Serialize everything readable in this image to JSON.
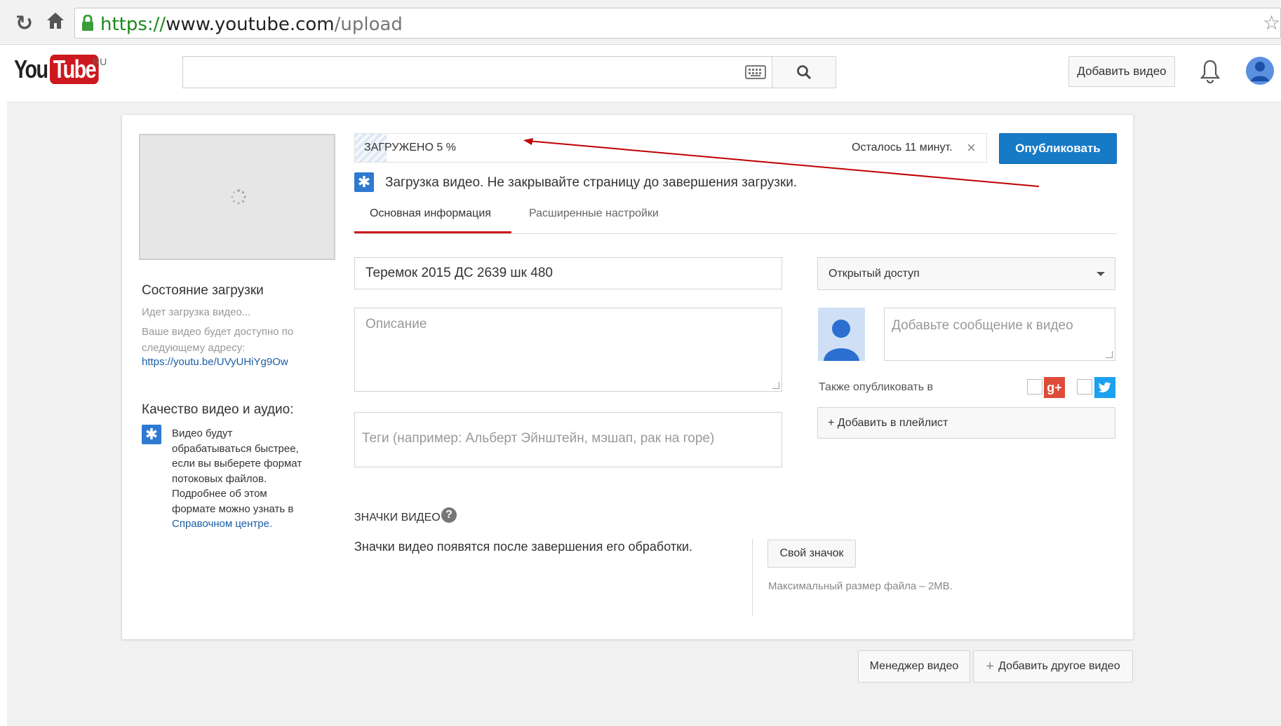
{
  "browser": {
    "url_scheme": "https://",
    "url_host": "www.youtube.com",
    "url_path": "/upload"
  },
  "header": {
    "logo_you": "You",
    "logo_tube": "Tube",
    "region": "RU",
    "upload_button": "Добавить видео"
  },
  "upload": {
    "progress_label": "ЗАГРУЖЕНО 5 %",
    "progress_percent": 5,
    "time_left": "Осталось 11 минут.",
    "publish_button": "Опубликовать",
    "notice": "Загрузка видео. Не закрывайте страницу до завершения загрузки."
  },
  "tabs": [
    {
      "label": "Основная информация",
      "active": true
    },
    {
      "label": "Расширенные настройки",
      "active": false
    }
  ],
  "sidebar": {
    "status_title": "Состояние загрузки",
    "status_text": "Идет загрузка видео...",
    "address_text_1": "Ваше видео будет доступно по",
    "address_text_2": "следующему адресу:",
    "video_link": "https://youtu.be/UVyUHiYg9Ow",
    "quality_title": "Качество видео и аудио:",
    "quality_lines": [
      "Видео будут",
      "обрабатываться быстрее,",
      "если вы выберете формат",
      "потоковых файлов.",
      "Подробнее об этом",
      "формате можно узнать в"
    ],
    "help_center_link": "Справочном центре."
  },
  "form": {
    "title_value": "Теремок 2015 ДС 2639 шк 480",
    "description_placeholder": "Описание",
    "tags_placeholder": "Теги (например: Альберт Эйнштейн, мэшап, рак на горе)",
    "privacy_value": "Открытый доступ",
    "message_placeholder": "Добавьте сообщение к видео",
    "also_publish": "Также опубликовать в",
    "add_playlist": "+ Добавить в плейлист"
  },
  "thumbnails": {
    "title": "ЗНАЧКИ ВИДЕО",
    "text": "Значки видео появятся после завершения его обработки.",
    "custom_button": "Свой значок",
    "max_size": "Максимальный размер файла – 2MB."
  },
  "footer": {
    "video_manager": "Менеджер видео",
    "add_another": "Добавить другое видео"
  },
  "colors": {
    "publish_blue": "#167ac6",
    "tab_red": "#cc181e",
    "link_blue": "#1a5ea6"
  }
}
